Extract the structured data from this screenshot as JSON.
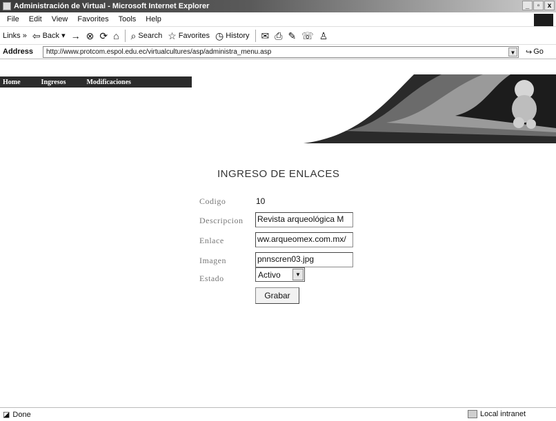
{
  "window": {
    "title": "Administración de Virtual - Microsoft Internet Explorer",
    "minimize": "_",
    "maximize": "▫",
    "close": "x"
  },
  "menu": [
    "File",
    "Edit",
    "View",
    "Favorites",
    "Tools",
    "Help"
  ],
  "toolbar": {
    "links": "Links »",
    "back": "Back",
    "search": "Search",
    "favorites": "Favorites",
    "history": "History"
  },
  "address": {
    "label": "Address",
    "url": "http://www.protcom.espol.edu.ec/virtualcultures/asp/administra_menu.asp",
    "go": "Go"
  },
  "site_nav": [
    "Home",
    "Ingresos",
    "Modificaciones"
  ],
  "form": {
    "title": "INGRESO DE ENLACES",
    "codigo_label": "Codigo",
    "codigo_value": "10",
    "descripcion_label": "Descripcion",
    "descripcion_value": "Revista arqueológica M",
    "enlace_label": "Enlace",
    "enlace_value": "ww.arqueomex.com.mx/",
    "imagen_label": "Imagen",
    "imagen_value": "pnnscren03.jpg",
    "estado_label": "Estado",
    "estado_value": "Activo",
    "submit_label": "Grabar"
  },
  "status": {
    "left": "Done",
    "zone": "Local intranet"
  }
}
